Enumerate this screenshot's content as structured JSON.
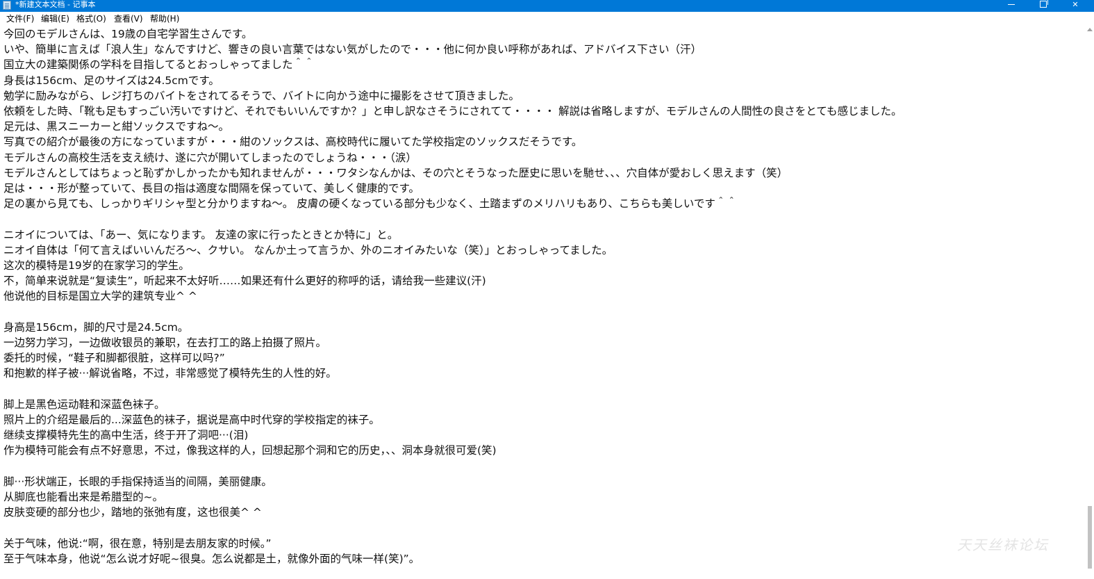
{
  "window": {
    "title": "*新建文本文档 - 记事本",
    "title_icon": "notepad-icon",
    "controls": {
      "minimize": "minimize-icon",
      "maximize": "restore-icon",
      "close": "close-icon"
    },
    "accent_color": "#0078d7"
  },
  "menu": {
    "items": [
      "文件(F)",
      "编辑(E)",
      "格式(O)",
      "查看(V)",
      "帮助(H)"
    ]
  },
  "editor": {
    "lines": [
      "今回のモデルさんは、19歳の自宅学習生さんです。",
      "いや、簡単に言えば「浪人生」なんですけど、響きの良い言葉ではない気がしたので・・・他に何か良い呼称があれば、アドバイス下さい（汗）",
      "国立大の建築関係の学科を目指してるとおっしゃってました＾＾",
      "身長は156cm、足のサイズは24.5cmです。",
      "勉学に励みながら、レジ打ちのバイトをされてるそうで、バイトに向かう途中に撮影をさせて頂きました。",
      "依頼をした時、「靴も足もすっごい汚いですけど、それでもいいんですか？」と申し訳なさそうにされてて・・・・ 解説は省略しますが、モデルさんの人間性の良さをとても感じました。",
      "足元は、黒スニーカーと紺ソックスですね～。",
      "写真での紹介が最後の方になっていますが・・・紺のソックスは、高校時代に履いてた学校指定のソックスだそうです。",
      "モデルさんの高校生活を支え続け、遂に穴が開いてしまったのでしょうね・・・（涙）",
      "モデルさんとしてはちょっと恥ずかしかったかも知れませんが・・・ワタシなんかは、その穴とそうなった歴史に思いを馳せ、、、穴自体が愛おしく思えます（笑）",
      "足は・・・形が整っていて、長目の指は適度な間隔を保っていて、美しく健康的です。",
      "足の裏から見ても、しっかりギリシャ型と分かりますね～。 皮膚の硬くなっている部分も少なく、土踏まずのメリハリもあり、こちらも美しいです＾＾",
      "",
      "ニオイについては、「あー、気になります。 友達の家に行ったときとか特に」と。",
      "ニオイ自体は「何て言えばいいんだろ～、クサい。 なんか土って言うか、外のニオイみたいな（笑）」とおっしゃってました。",
      "这次的模特是19岁的在家学习的学生。",
      "不，简单来说就是“复读生”，听起来不太好听……如果还有什么更好的称呼的话，请给我一些建议(汗)",
      "他说他的目标是国立大学的建筑专业^ ^",
      "",
      "身高是156cm，脚的尺寸是24.5cm。",
      "一边努力学习，一边做收银员的兼职，在去打工的路上拍摄了照片。",
      "委托的时候，“鞋子和脚都很脏，这样可以吗?”",
      "和抱歉的样子被···解说省略，不过，非常感觉了模特先生的人性的好。",
      "",
      "脚上是黑色运动鞋和深蓝色袜子。",
      "照片上的介绍是最后的...深蓝色的袜子，据说是高中时代穿的学校指定的袜子。",
      "继续支撑模特先生的高中生活，终于开了洞吧···(泪)",
      "作为模特可能会有点不好意思，不过，像我这样的人，回想起那个洞和它的历史，、、洞本身就很可爱(笑)",
      "",
      "脚···形状端正，长眼的手指保持适当的间隔，美丽健康。",
      "从脚底也能看出来是希腊型的~。",
      "皮肤变硬的部分也少，踏地的张弛有度，这也很美^ ^",
      "",
      "关于气味，他说:“啊，很在意，特别是去朋友家的时候。”",
      "至于气味本身，他说“怎么说才好呢~很臭。怎么说都是土，就像外面的气味一样(笑)”。"
    ]
  },
  "watermark": "天天丝袜论坛"
}
